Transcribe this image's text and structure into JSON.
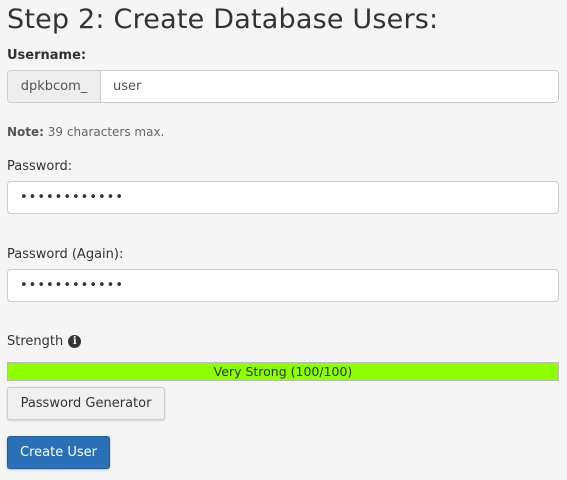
{
  "page_title": "Step 2: Create Database Users:",
  "username": {
    "label": "Username:",
    "prefix": "dpkbcom_",
    "value": "user"
  },
  "note": {
    "bold": "Note:",
    "text": "39 characters max."
  },
  "password": {
    "label": "Password:",
    "value": "••••••••••••"
  },
  "password_again": {
    "label": "Password (Again):",
    "value": "••••••••••••"
  },
  "strength": {
    "label": "Strength",
    "info_icon": "info-circle-icon",
    "meter_text": "Very Strong (100/100)",
    "meter_percent": 100,
    "meter_color": "#8cff00"
  },
  "buttons": {
    "password_generator": "Password Generator",
    "create_user": "Create User"
  },
  "colors": {
    "primary": "#2a70b8"
  }
}
